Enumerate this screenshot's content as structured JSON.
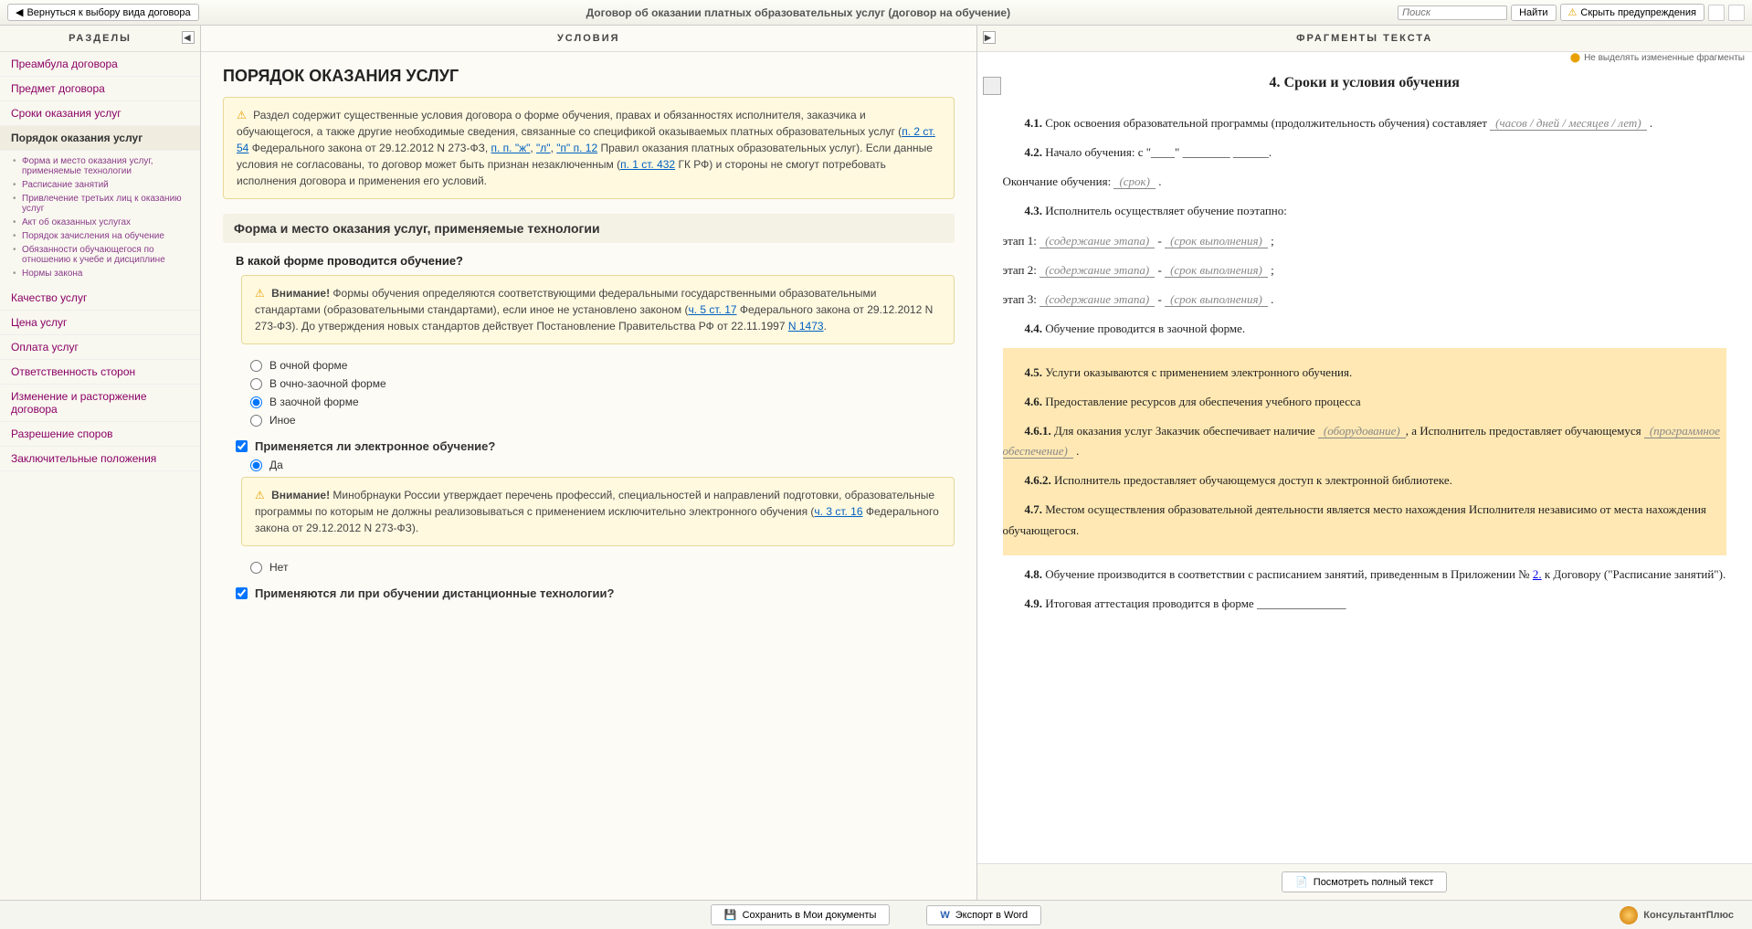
{
  "topbar": {
    "back": "Вернуться к выбору вида договора",
    "title": "Договор об оказании платных образовательных услуг (договор на обучение)",
    "search_placeholder": "Поиск",
    "find": "Найти",
    "hide_warnings": "Скрыть предупреждения"
  },
  "sidebar": {
    "header": "РАЗДЕЛЫ",
    "items": [
      "Преамбула договора",
      "Предмет договора",
      "Сроки оказания услуг",
      "Порядок оказания услуг",
      "Качество услуг",
      "Цена услуг",
      "Оплата услуг",
      "Ответственность сторон",
      "Изменение и расторжение договора",
      "Разрешение споров",
      "Заключительные положения"
    ],
    "sub": [
      "Форма и место оказания услуг, применяемые технологии",
      "Расписание занятий",
      "Привлечение третьих лиц к оказанию услуг",
      "Акт об оказанных услугах",
      "Порядок зачисления на обучение",
      "Обязанности обучающегося по отношению к учебе и дисциплине",
      "Нормы закона"
    ]
  },
  "conditions": {
    "header": "УСЛОВИЯ",
    "title": "ПОРЯДОК ОКАЗАНИЯ УСЛУГ",
    "info1_pre": "Раздел содержит существенные условия договора о форме обучения, правах и обязанностях исполнителя, заказчика и обучающегося, а также другие необходимые сведения, связанные со спецификой оказываемых платных образовательных услуг (",
    "info1_link1": "п. 2 ст. 54",
    "info1_mid1": " Федерального закона от 29.12.2012 N 273-ФЗ, ",
    "info1_link2": "п. п. \"ж\"",
    "info1_link3": "\"л\"",
    "info1_link4": "\"п\" п. 12",
    "info1_mid2": " Правил оказания платных образовательных услуг). Если данные условия не согласованы, то договор может быть признан незаключенным (",
    "info1_link5": "п. 1 ст. 432",
    "info1_end": " ГК РФ) и стороны не смогут потребовать исполнения договора и применения его условий.",
    "subsec": "Форма и место оказания услуг, применяемые технологии",
    "q1": "В какой форме проводится обучение?",
    "warn1_label": "Внимание!",
    "warn1_pre": " Формы обучения определяются соответствующими федеральными государственными образовательными стандартами (образовательными стандартами), если иное не установлено законом (",
    "warn1_link1": "ч. 5 ст. 17",
    "warn1_mid": " Федерального закона от 29.12.2012 N 273-ФЗ). До утверждения новых стандартов действует Постановление Правительства РФ от 22.11.1997 ",
    "warn1_link2": "N 1473",
    "opts1": [
      "В очной форме",
      "В очно-заочной форме",
      "В заочной форме",
      "Иное"
    ],
    "q2": "Применяется ли электронное обучение?",
    "opts2": [
      "Да",
      "Нет"
    ],
    "warn2_label": "Внимание!",
    "warn2_pre": " Минобрнауки России утверждает перечень профессий, специальностей и направлений подготовки, образовательные программы по которым не должны реализовываться с применением исключительно электронного обучения (",
    "warn2_link": "ч. 3 ст. 16",
    "warn2_end": " Федерального закона от 29.12.2012 N 273-ФЗ).",
    "q3": "Применяются ли при обучении дистанционные технологии?"
  },
  "preview": {
    "header": "ФРАГМЕНТЫ ТЕКСТА",
    "highlight_toggle": "Не выделять измененные фрагменты",
    "title": "4. Сроки и условия обучения",
    "p41_a": "4.1.",
    "p41_b": " Срок освоения образовательной программы (продолжительность обучения) составляет ",
    "p41_ph": "(часов / дней / месяцев / лет)",
    "p42_a": "4.2.",
    "p42_b": " Начало обучения: с \"____\" ________ ______.",
    "p42_end_a": "Окончание обучения: ",
    "p42_end_ph": "(срок)",
    "p43_a": "4.3.",
    "p43_b": " Исполнитель осуществляет обучение поэтапно:",
    "stages": [
      {
        "label": "этап 1:",
        "ph1": "(содержание этапа)",
        "ph2": "(срок выполнения)"
      },
      {
        "label": "этап 2:",
        "ph1": "(содержание этапа)",
        "ph2": "(срок выполнения)"
      },
      {
        "label": "этап 3:",
        "ph1": "(содержание этапа)",
        "ph2": "(срок выполнения)"
      }
    ],
    "p44_a": "4.4.",
    "p44_b": " Обучение проводится в заочной форме.",
    "p45_a": "4.5.",
    "p45_b": " Услуги оказываются с применением электронного обучения.",
    "p46_a": "4.6.",
    "p46_b": " Предоставление ресурсов для обеспечения учебного процесса",
    "p461_a": "4.6.1.",
    "p461_b": " Для оказания услуг Заказчик обеспечивает наличие ",
    "p461_ph1": "(оборудование)",
    "p461_c": ", а Исполнитель предоставляет обучающемуся ",
    "p461_ph2": "(программное обеспечение)",
    "p462_a": "4.6.2.",
    "p462_b": " Исполнитель предоставляет обучающемуся доступ к электронной библиотеке.",
    "p47_a": "4.7.",
    "p47_b": " Местом осуществления образовательной деятельности является место нахождения Исполнителя независимо от места нахождения обучающегося.",
    "p48_a": "4.8.",
    "p48_b": " Обучение производится в соответствии с расписанием занятий, приведенным в Приложении № ",
    "p48_link": "2.",
    "p48_c": " к Договору (\"Расписание занятий\").",
    "p49_a": "4.9.",
    "p49_b": " Итоговая аттестация проводится в форме _______________",
    "full_text": "Посмотреть полный текст"
  },
  "footer": {
    "save": "Сохранить в Мои документы",
    "export": "Экспорт в Word",
    "brand": "КонсультантПлюс"
  }
}
